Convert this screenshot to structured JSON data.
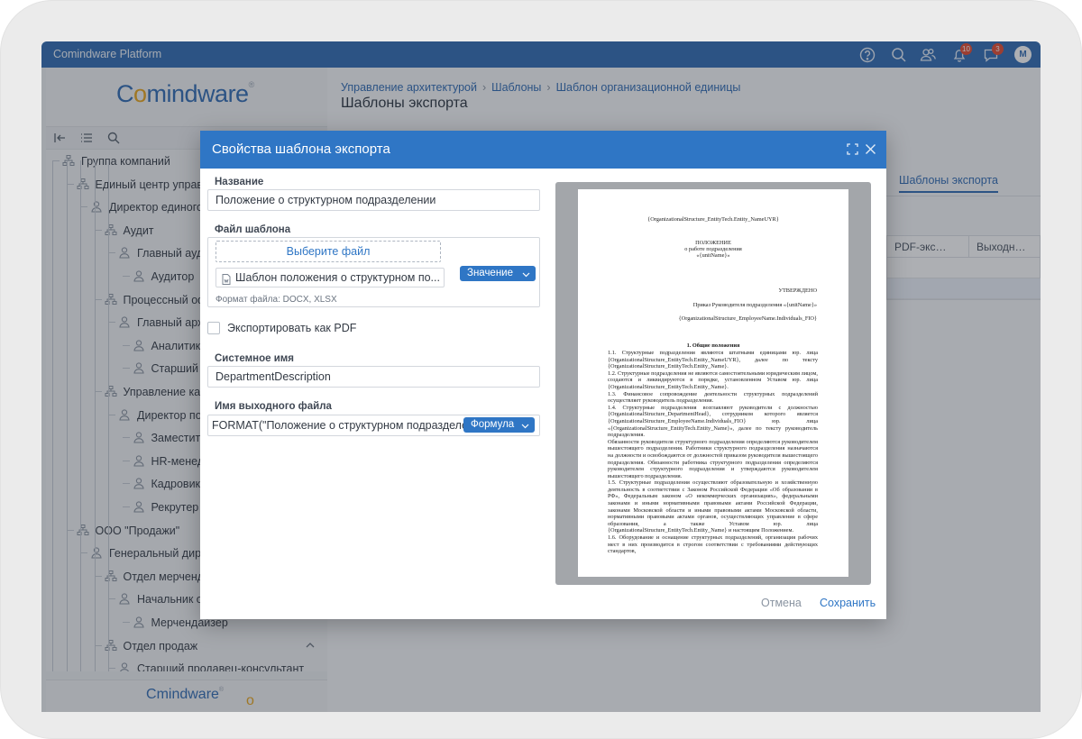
{
  "app": {
    "title": "Comindware Platform",
    "logo": "Comindware",
    "footer_logo": "Comindware"
  },
  "topbar": {
    "notifications_count": "10",
    "messages_count": "3",
    "avatar_initial": "M",
    "icons": [
      "help-icon",
      "search-icon",
      "users-icon",
      "bell-icon",
      "chat-icon"
    ]
  },
  "sidebar": {
    "tree": [
      {
        "label": "Группа компаний",
        "type": "org",
        "level": 0
      },
      {
        "label": "Единый центр управления",
        "type": "org",
        "level": 1
      },
      {
        "label": "Директор единого центра",
        "type": "person",
        "level": 2
      },
      {
        "label": "Аудит",
        "type": "org",
        "level": 3
      },
      {
        "label": "Главный аудитор",
        "type": "person",
        "level": 4
      },
      {
        "label": "Аудитор",
        "type": "person",
        "level": 5
      },
      {
        "label": "Процессный офис",
        "type": "org",
        "level": 3
      },
      {
        "label": "Главный архитектор",
        "type": "person",
        "level": 4
      },
      {
        "label": "Аналитик",
        "type": "person",
        "level": 5
      },
      {
        "label": "Старший аналитик",
        "type": "person",
        "level": 5
      },
      {
        "label": "Управление кадрами",
        "type": "org",
        "level": 3
      },
      {
        "label": "Директор по персоналу",
        "type": "person",
        "level": 4
      },
      {
        "label": "Заместитель",
        "type": "person",
        "level": 5
      },
      {
        "label": "HR-менеджер",
        "type": "person",
        "level": 5
      },
      {
        "label": "Кадровик",
        "type": "person",
        "level": 5
      },
      {
        "label": "Рекрутер",
        "type": "person",
        "level": 5
      },
      {
        "label": "ООО \"Продажи\"",
        "type": "org",
        "level": 1
      },
      {
        "label": "Генеральный директор",
        "type": "person",
        "level": 2
      },
      {
        "label": "Отдел мерчендайзинга",
        "type": "org",
        "level": 3
      },
      {
        "label": "Начальник отдела",
        "type": "person",
        "level": 4
      },
      {
        "label": "Мерчендайзер",
        "type": "person",
        "level": 5
      },
      {
        "label": "Отдел продаж",
        "type": "org",
        "level": 3
      },
      {
        "label": "Старший продавец-консультант",
        "type": "person",
        "level": 4
      }
    ]
  },
  "main": {
    "breadcrumbs": [
      "Управление архитектурой",
      "Шаблоны",
      "Шаблон организационной единицы"
    ],
    "page_title": "Шаблоны экспорта",
    "active_tab": "Шаблоны экспорта",
    "columns": [
      "PDF-экс…",
      "Выходн…"
    ]
  },
  "modal": {
    "title": "Свойства шаблона экспорта",
    "name_label": "Название",
    "name_value": "Положение о структурном подразделении",
    "file_label": "Файл шаблона",
    "choose_file": "Выберите файл",
    "file_name": "Шаблон положения о структурном по...",
    "value_button": "Значение",
    "file_format": "Формат файла: DOCX, XLSX",
    "export_pdf_label": "Экспортировать как PDF",
    "export_pdf_checked": false,
    "system_name_label": "Системное имя",
    "system_name_value": "DepartmentDescription",
    "output_label": "Имя выходного файла",
    "output_value": "FORMAT(\"Положение о структурном подразделении",
    "formula_button": "Формула",
    "cancel": "Отмена",
    "save": "Сохранить"
  },
  "preview": {
    "header": "{OrganizationalStructure_EntityTech.Entity_NameUYR}",
    "doc_title": "ПОЛОЖЕНИЕ",
    "doc_sub1": "о работе подразделения",
    "doc_sub2": "«{unitName}»",
    "approved": "УТВЕРЖДЕНО",
    "order": "Приказ Руководителя подразделения «{unitName}»",
    "fio": "{OrganizationalStructure_EmployeeName.Individuals_FIO}",
    "section": "1.    Общие положения",
    "paragraphs": [
      "1.1. Структурные подразделения являются штатными единицами юр. лица {OrganizationalStructure_EntityTech.Entity_NameUYR}, далее по тексту {OrganizationalStructure_EntityTech.Entity_Name}.",
      "1.2. Структурные подразделения не являются самостоятельными юридическим лицом, создаются и ликвидируются в порядке, установленном Уставом юр. лица {OrganizationalStructure_EntityTech.Entity_Name}.",
      "1.3. Финансовое сопровождение деятельности структурных подразделений осуществляет руководитель подразделения.",
      "1.4. Структурные подразделения возглавляют руководители с должностью {OrganizationalStructure_DepartmentHead}, сотрудником которого является {OrganizationalStructure_EmployeeName.Individuals_FIO} юр. лица «{OrganizationalStructure_EntityTech.Entity_Name}», далее по тексту руководитель подразделения.",
      "Обязанности руководителя структурного подразделения определяются руководителем вышестоящего подразделения. Работники структурного подразделения назначаются на должности и освобождаются от должностей приказом руководителя вышестоящего подразделения. Обязанности работника структурного подразделения определяются руководителем структурного подразделения и утверждаются руководителем вышестоящего подразделения.",
      "1.5. Структурные подразделения осуществляют образовательную и хозяйственную деятельность в соответствии с Законом Российской Федерации «Об образовании в РФ», Федеральным законом «О некоммерческих организациях», федеральными законами и иными нормативными правовыми актами Российской Федерации, законами Московской области и иными правовыми актами Московской области, нормативными правовыми актами органов, осуществляющих управление в сфере образования, а также Уставом юр. лица {OrganizationalStructure_EntityTech.Entity_Name} и настоящим Положением.",
      "1.6. Оборудование и оснащение структурных подразделений, организация рабочих мест в них производится в строгом соответствии с требованиями действующих стандартов,"
    ]
  },
  "colors": {
    "primary": "#2f76c5",
    "topbar": "#2f6bb4",
    "accent": "#e9a51a",
    "badge": "#e64a2e"
  }
}
